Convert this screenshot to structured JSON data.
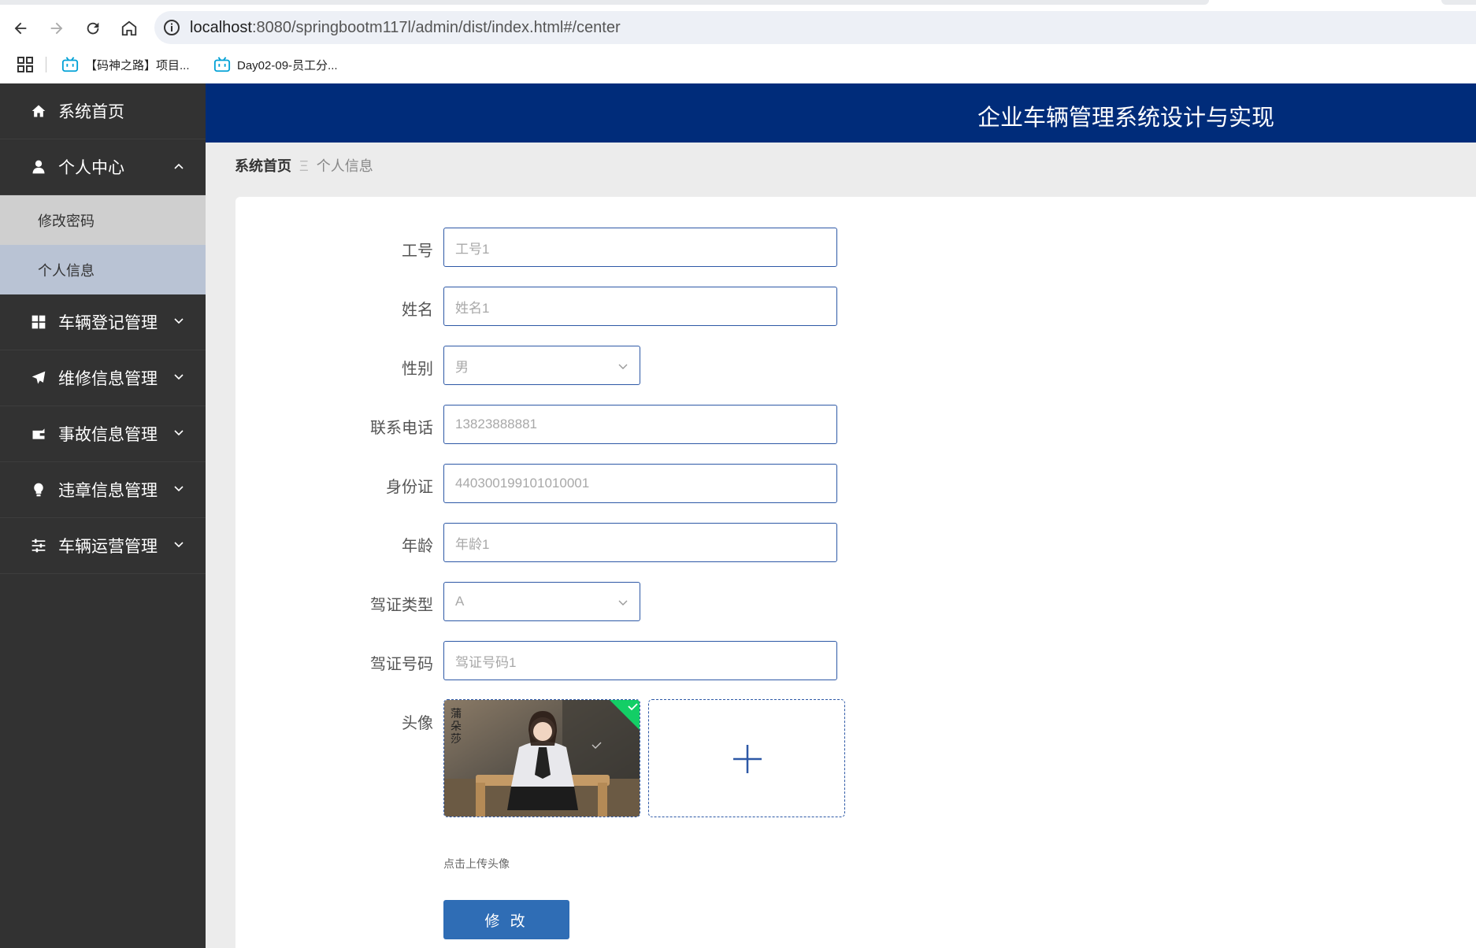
{
  "browser": {
    "url_host": "localhost",
    "url_rest": ":8080/springbootm117l/admin/dist/index.html#/center",
    "bookmarks": [
      "【码神之路】项目...",
      "Day02-09-员工分..."
    ]
  },
  "app": {
    "title": "企业车辆管理系统设计与实现"
  },
  "sidebar": {
    "home": "系统首页",
    "personal": "个人中心",
    "sub": [
      "修改密码",
      "个人信息"
    ],
    "menus": [
      "车辆登记管理",
      "维修信息管理",
      "事故信息管理",
      "违章信息管理",
      "车辆运营管理"
    ]
  },
  "breadcrumb": {
    "home": "系统首页",
    "sep": "Ξ",
    "current": "个人信息"
  },
  "form": {
    "labels": {
      "job_no": "工号",
      "name": "姓名",
      "gender": "性别",
      "phone": "联系电话",
      "id_card": "身份证",
      "age": "年龄",
      "license_type": "驾证类型",
      "license_no": "驾证号码",
      "avatar": "头像"
    },
    "values": {
      "job_no": "工号1",
      "name": "姓名1",
      "gender": "男",
      "phone": "13823888881",
      "id_card": "440300199101010001",
      "age": "年龄1",
      "license_type": "A",
      "license_no": "驾证号码1"
    },
    "upload_hint": "点击上传头像",
    "submit": "修 改"
  },
  "colors": {
    "sidebar_bg": "#323232",
    "topbar_bg": "#002c7a",
    "accent": "#2f6db5"
  }
}
